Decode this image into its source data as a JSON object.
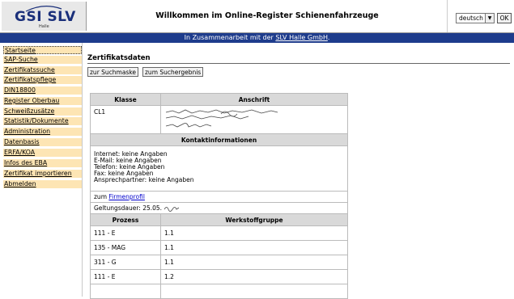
{
  "header": {
    "logo_text": "GSI SLV",
    "logo_sub": "Halle",
    "title": "Willkommen im Online-Register Schienenfahrzeuge",
    "language": "deutsch",
    "ok_label": "OK"
  },
  "banner": {
    "prefix": "In Zusammenarbeit mit der ",
    "link": "SLV Halle GmbH",
    "suffix": "."
  },
  "sidebar": {
    "items": [
      {
        "label": "Startseite"
      },
      {
        "label": "SAP-Suche"
      },
      {
        "label": "Zertifikatssuche"
      },
      {
        "label": "Zertifikatspflege"
      },
      {
        "label": "DIN18800"
      },
      {
        "label": "Register Oberbau"
      },
      {
        "label": "Schweißzusätze"
      },
      {
        "label": "Statistik/Dokumente"
      },
      {
        "label": "Administration"
      },
      {
        "label": "Datenbasis"
      },
      {
        "label": "ERFA/KOA"
      },
      {
        "label": "Infos des EBA"
      },
      {
        "label": "Zertifikat importieren"
      },
      {
        "label": "Abmelden"
      }
    ]
  },
  "main": {
    "section_title": "Zertifikatsdaten",
    "btn_search_mask": "zur Suchmaske",
    "btn_search_result": "zum Suchergebnis",
    "table": {
      "col_class": "Klasse",
      "col_address": "Anschrift",
      "class_value": "CL1",
      "contact_header": "Kontaktinformationen",
      "contact_lines": [
        "Internet: keine Angaben",
        "E-Mail: keine Angaben",
        "Telefon: keine Angaben",
        "Fax: keine Angaben",
        "Ansprechpartner: keine Angaben"
      ],
      "profile_prefix": "zum ",
      "profile_link": "Firmenprofil",
      "validity": "Geltungsdauer: 25.05.",
      "col_process": "Prozess",
      "col_material": "Werkstoffgruppe",
      "rows": [
        {
          "process": "111 - E",
          "material": "1.1"
        },
        {
          "process": "135 - MAG",
          "material": "1.1"
        },
        {
          "process": "311 - G",
          "material": "1.1"
        },
        {
          "process": "111 - E",
          "material": "1.2"
        }
      ]
    }
  }
}
